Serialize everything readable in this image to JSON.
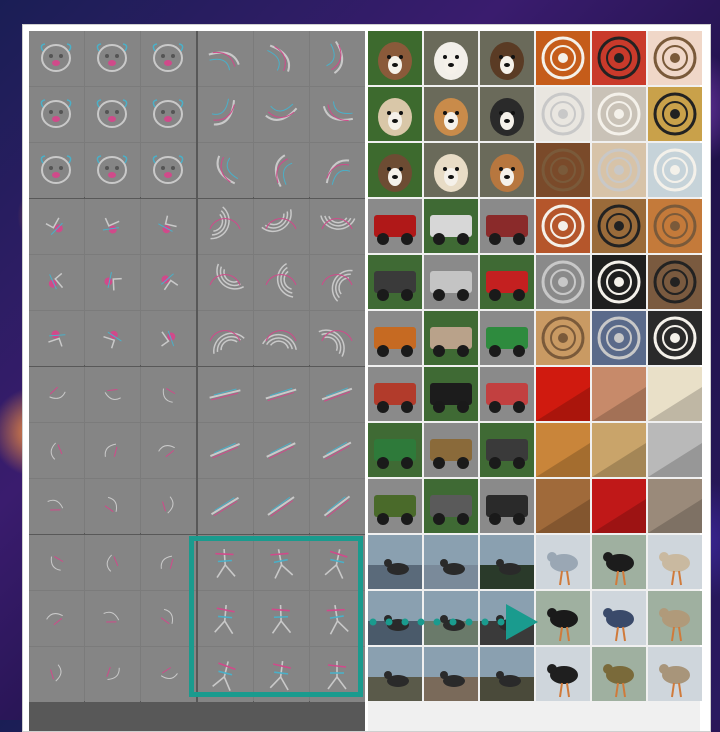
{
  "slide": {
    "accent_color": "#1a9b8e"
  },
  "left_panel": {
    "groups": [
      {
        "topic": "dog-face",
        "variant": "face"
      },
      {
        "topic": "curved-strokes",
        "variant": "strokes"
      },
      {
        "topic": "pink-blobs",
        "variant": "blob"
      },
      {
        "topic": "spiral-rings",
        "variant": "rings"
      },
      {
        "topic": "faint-shapes",
        "variant": "faint"
      },
      {
        "topic": "diagonal-lines",
        "variant": "diag"
      },
      {
        "topic": "faint-marks",
        "variant": "faint"
      },
      {
        "topic": "bird-legs",
        "variant": "legs"
      }
    ]
  },
  "right_panel": {
    "groups": [
      {
        "topic": "dogs",
        "palette": [
          "#8a5a3a",
          "#f2efe9",
          "#5a3b24",
          "#d9c7a8",
          "#c98b4a",
          "#2a2a2a",
          "#6d4c33",
          "#e8dcc6",
          "#b7773f"
        ]
      },
      {
        "topic": "round-objects",
        "palette": [
          "#c55c1a",
          "#c93a2b",
          "#f0d7c8",
          "#e9e6e0",
          "#c9c2b7",
          "#c9a14a",
          "#7a4a2a",
          "#d7c3a8",
          "#c6d3d9"
        ]
      },
      {
        "topic": "vehicles-red",
        "palette": [
          "#b01818",
          "#d7d7d7",
          "#8a2a2a",
          "#3a3a3a",
          "#c4c4c4",
          "#c42020",
          "#c66a22",
          "#b9a28a",
          "#2e8b3e"
        ]
      },
      {
        "topic": "spirals",
        "palette": [
          "#b5562b",
          "#9a6b3a",
          "#c47a3a",
          "#8a8a8a",
          "#1f1f1f",
          "#7a5a3f",
          "#c99a63",
          "#5a6a8a",
          "#2a2a2a"
        ]
      },
      {
        "topic": "outdoor-vehicles",
        "palette": [
          "#b23b2b",
          "#1c1c1c",
          "#c24040",
          "#2e7a3a",
          "#8a6a3a",
          "#3a3a3a",
          "#4a6a2a",
          "#5a5a5a",
          "#2a2a2a"
        ]
      },
      {
        "topic": "red-surfaces",
        "palette": [
          "#d01a0f",
          "#c78a6a",
          "#e9e0c8",
          "#c9853a",
          "#c9a46a",
          "#b9b9b9",
          "#a06a3a",
          "#c01818",
          "#9a8a7a"
        ]
      },
      {
        "topic": "water-birds",
        "palette": [
          "#5a6a7a",
          "#7a8a9a",
          "#2a3a2a",
          "#4a5a6a",
          "#6a7a6a",
          "#3a3a3a",
          "#5a5a4a",
          "#7a6a5a",
          "#4a4a3a"
        ]
      },
      {
        "topic": "birds",
        "palette": [
          "#9aa7b4",
          "#1c1c1c",
          "#c9b9a0",
          "#1a1a1a",
          "#3a4a6a",
          "#b09a7a",
          "#1f1f1f",
          "#7a6a3a",
          "#a8957a"
        ]
      }
    ]
  }
}
